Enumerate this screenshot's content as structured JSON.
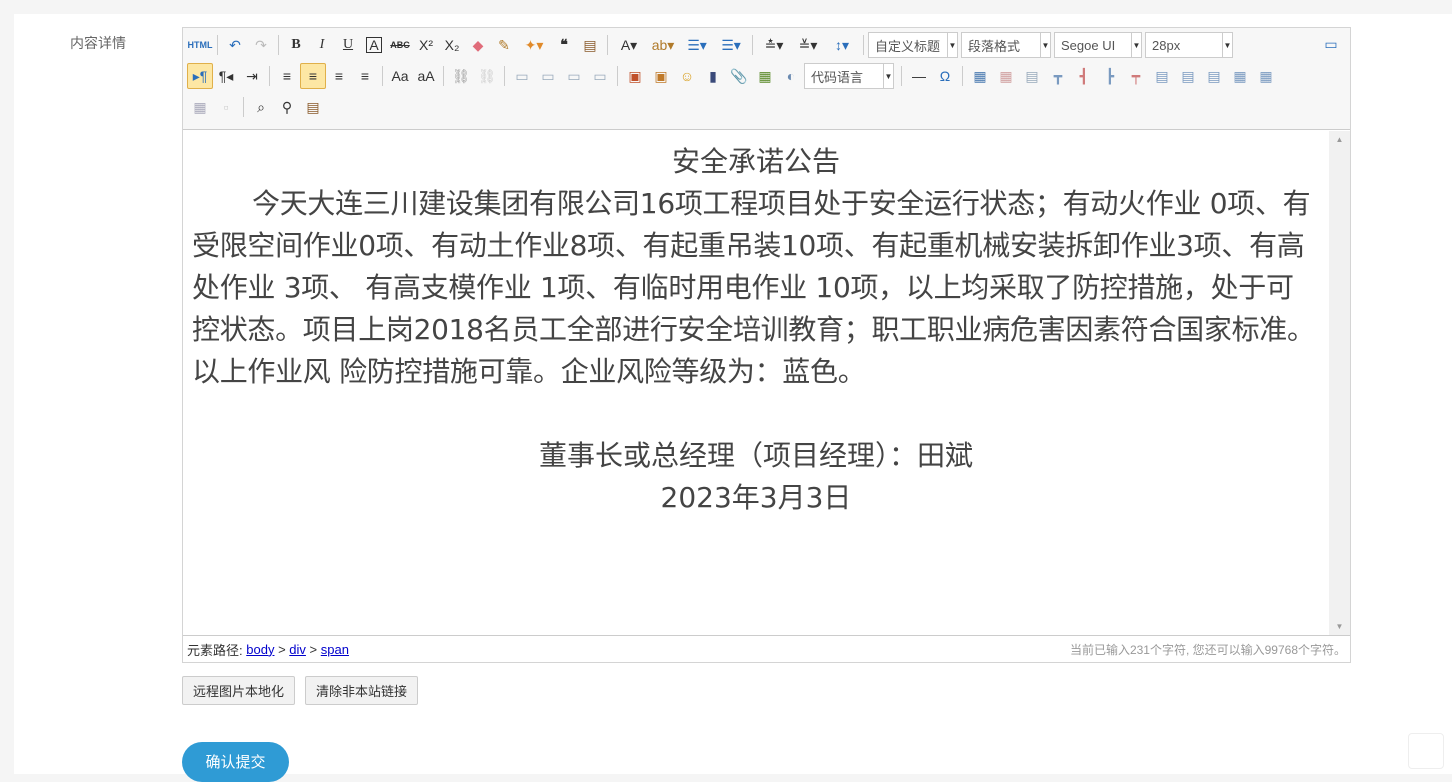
{
  "form": {
    "label": "内容详情"
  },
  "toolbar": {
    "row1": [
      {
        "name": "source-html-button",
        "glyph": "HTML",
        "color": "#2a6ebb",
        "small": true
      },
      {
        "sep": true
      },
      {
        "name": "undo-button",
        "glyph": "↶",
        "color": "#2a6ebb"
      },
      {
        "name": "redo-button",
        "glyph": "↷",
        "color": "#bbbbbb"
      },
      {
        "sep": true
      },
      {
        "name": "bold-button",
        "glyph": "B",
        "bold": true
      },
      {
        "name": "italic-button",
        "glyph": "I",
        "italic": true
      },
      {
        "name": "underline-button",
        "glyph": "U",
        "underline": true
      },
      {
        "name": "font-border-button",
        "glyph": "A",
        "boxed": true
      },
      {
        "name": "strikethrough-button",
        "glyph": "ABC",
        "strike": true,
        "small": true
      },
      {
        "name": "superscript-button",
        "glyph": "X²"
      },
      {
        "name": "subscript-button",
        "glyph": "X₂"
      },
      {
        "name": "eraser-icon",
        "glyph": "◆",
        "color": "#e06c7a"
      },
      {
        "name": "format-brush-icon",
        "glyph": "✎",
        "color": "#b07a2a"
      },
      {
        "name": "auto-format-icon",
        "glyph": "✦▾",
        "color": "#e08a2a",
        "wide": true
      },
      {
        "name": "blockquote-button",
        "glyph": "❝",
        "bold": true
      },
      {
        "name": "paste-plain-icon",
        "glyph": "▤",
        "color": "#8a5a2a"
      },
      {
        "sep": true
      },
      {
        "name": "font-color-button",
        "glyph": "A▾",
        "wide": true
      },
      {
        "name": "highlight-color-button",
        "glyph": "ab▾",
        "color": "#b07a2a",
        "wide": true
      },
      {
        "name": "ordered-list-button",
        "glyph": "☰▾",
        "color": "#2a6ebb",
        "wide": true
      },
      {
        "name": "unordered-list-button",
        "glyph": "☰▾",
        "color": "#2a6ebb",
        "wide": true
      },
      {
        "sep": true
      },
      {
        "name": "row-spacing-top-button",
        "glyph": "≛▾",
        "wide": true
      },
      {
        "name": "row-spacing-bottom-button",
        "glyph": "≚▾",
        "wide": true
      },
      {
        "name": "line-height-button",
        "glyph": "↕▾",
        "color": "#2a6ebb",
        "wide": true
      }
    ],
    "combos": {
      "heading": "自定义标题",
      "paragraph": "段落格式",
      "font": "Segoe UI",
      "size": "28px",
      "code_lang": "代码语言"
    },
    "row2": [
      {
        "name": "ltr-direction-button",
        "glyph": "▸¶",
        "active": true,
        "color": "#2a6ebb"
      },
      {
        "name": "rtl-direction-button",
        "glyph": "¶◂"
      },
      {
        "name": "indent-button",
        "glyph": "⇥"
      },
      {
        "sep": true
      },
      {
        "name": "align-left-button",
        "glyph": "≡"
      },
      {
        "name": "align-center-button",
        "glyph": "≡",
        "active": true
      },
      {
        "name": "align-right-button",
        "glyph": "≡"
      },
      {
        "name": "align-justify-button",
        "glyph": "≡"
      },
      {
        "sep": true
      },
      {
        "name": "to-uppercase-button",
        "glyph": "Aa"
      },
      {
        "name": "to-lowercase-button",
        "glyph": "aA"
      },
      {
        "sep": true
      },
      {
        "name": "link-button",
        "glyph": "⛓",
        "color": "#999"
      },
      {
        "name": "unlink-button",
        "glyph": "⛓",
        "color": "#ccc"
      },
      {
        "sep": true
      },
      {
        "name": "image-none-button",
        "glyph": "▭",
        "color": "#9ab"
      },
      {
        "name": "image-left-button",
        "glyph": "▭",
        "color": "#9ab"
      },
      {
        "name": "image-right-button",
        "glyph": "▭",
        "color": "#9ab"
      },
      {
        "name": "image-center-button",
        "glyph": "▭",
        "color": "#9ab"
      },
      {
        "sep": true
      },
      {
        "name": "insert-image-icon",
        "glyph": "▣",
        "color": "#c0502a"
      },
      {
        "name": "multi-image-icon",
        "glyph": "▣",
        "color": "#c07a2a"
      },
      {
        "name": "emotion-icon",
        "glyph": "☺",
        "color": "#d9a020"
      },
      {
        "name": "insert-video-icon",
        "glyph": "▮",
        "color": "#3a4a7a"
      },
      {
        "name": "attachment-icon",
        "glyph": "📎",
        "color": "#2a6ebb"
      },
      {
        "name": "insert-frame-icon",
        "glyph": "▦",
        "color": "#5a8a2a"
      },
      {
        "name": "background-icon",
        "glyph": "◐",
        "color": "#6a8ab0"
      }
    ],
    "row2b": [
      {
        "name": "horizontal-rule-button",
        "glyph": "—"
      },
      {
        "name": "special-chars-button",
        "glyph": "Ω",
        "color": "#2a6ebb"
      },
      {
        "sep": true
      },
      {
        "name": "insert-table-icon",
        "glyph": "▦",
        "color": "#4a7ab0"
      },
      {
        "name": "delete-table-icon",
        "glyph": "▦",
        "color": "#d0a0a0"
      },
      {
        "name": "insert-caption-icon",
        "glyph": "▤",
        "color": "#9ab"
      },
      {
        "name": "insert-row-icon",
        "glyph": "┳",
        "color": "#7a9ac0"
      },
      {
        "name": "delete-row-icon",
        "glyph": "┫",
        "color": "#d07a7a"
      },
      {
        "name": "insert-col-icon",
        "glyph": "┣",
        "color": "#7a9ac0"
      },
      {
        "name": "delete-col-icon",
        "glyph": "┯",
        "color": "#d07a7a"
      },
      {
        "name": "merge-cells-icon",
        "glyph": "▤",
        "color": "#7a9ac0"
      },
      {
        "name": "merge-right-icon",
        "glyph": "▤",
        "color": "#7a9ac0"
      },
      {
        "name": "merge-down-icon",
        "glyph": "▤",
        "color": "#7a9ac0"
      },
      {
        "name": "split-cells-icon",
        "glyph": "▦",
        "color": "#7a9ac0"
      },
      {
        "name": "split-rows-icon",
        "glyph": "▦",
        "color": "#7a9ac0"
      }
    ],
    "row3": [
      {
        "name": "split-cols-icon",
        "glyph": "▦",
        "color": "#aab"
      },
      {
        "name": "print-preview-icon",
        "glyph": "▫",
        "color": "#ccc"
      },
      {
        "sep": true
      },
      {
        "name": "preview-search-icon",
        "glyph": "⌕",
        "color": "#333"
      },
      {
        "name": "find-replace-icon",
        "glyph": "⚲",
        "color": "#333"
      },
      {
        "name": "drafts-icon",
        "glyph": "▤",
        "color": "#8a5a2a"
      }
    ],
    "fullscreen_icon": "▭"
  },
  "content": {
    "title": "安全承诺公告",
    "paragraph": "今天大连三川建设集团有限公司16项工程项目处于安全运行状态；有动火作业 0项、有受限空间作业0项、有动土作业8项、有起重吊装10项、有起重机械安装拆卸作业3项、有高处作业 3项、 有高支模作业 1项、有临时用电作业 10项，以上均采取了防控措施，处于可控状态。项目上岗2018名员工全部进行安全培训教育；职工职业病危害因素符合国家标准。以上作业风 险防控措施可靠。企业风险等级为：蓝色。",
    "signature": "董事长或总经理（项目经理）：田斌",
    "date": "2023年3月3日"
  },
  "statusbar": {
    "path_label": "元素路径:",
    "path": [
      "body",
      "div",
      "span"
    ],
    "separator": ">",
    "count_text": "当前已输入231个字符, 您还可以输入99768个字符。"
  },
  "actions": {
    "remote_images": "远程图片本地化",
    "clear_links": "清除非本站链接",
    "submit": "确认提交"
  },
  "colors": {
    "submit_bg": "#2f9bd5",
    "active_btn": "#fde7a4",
    "link": "#0000cc"
  }
}
